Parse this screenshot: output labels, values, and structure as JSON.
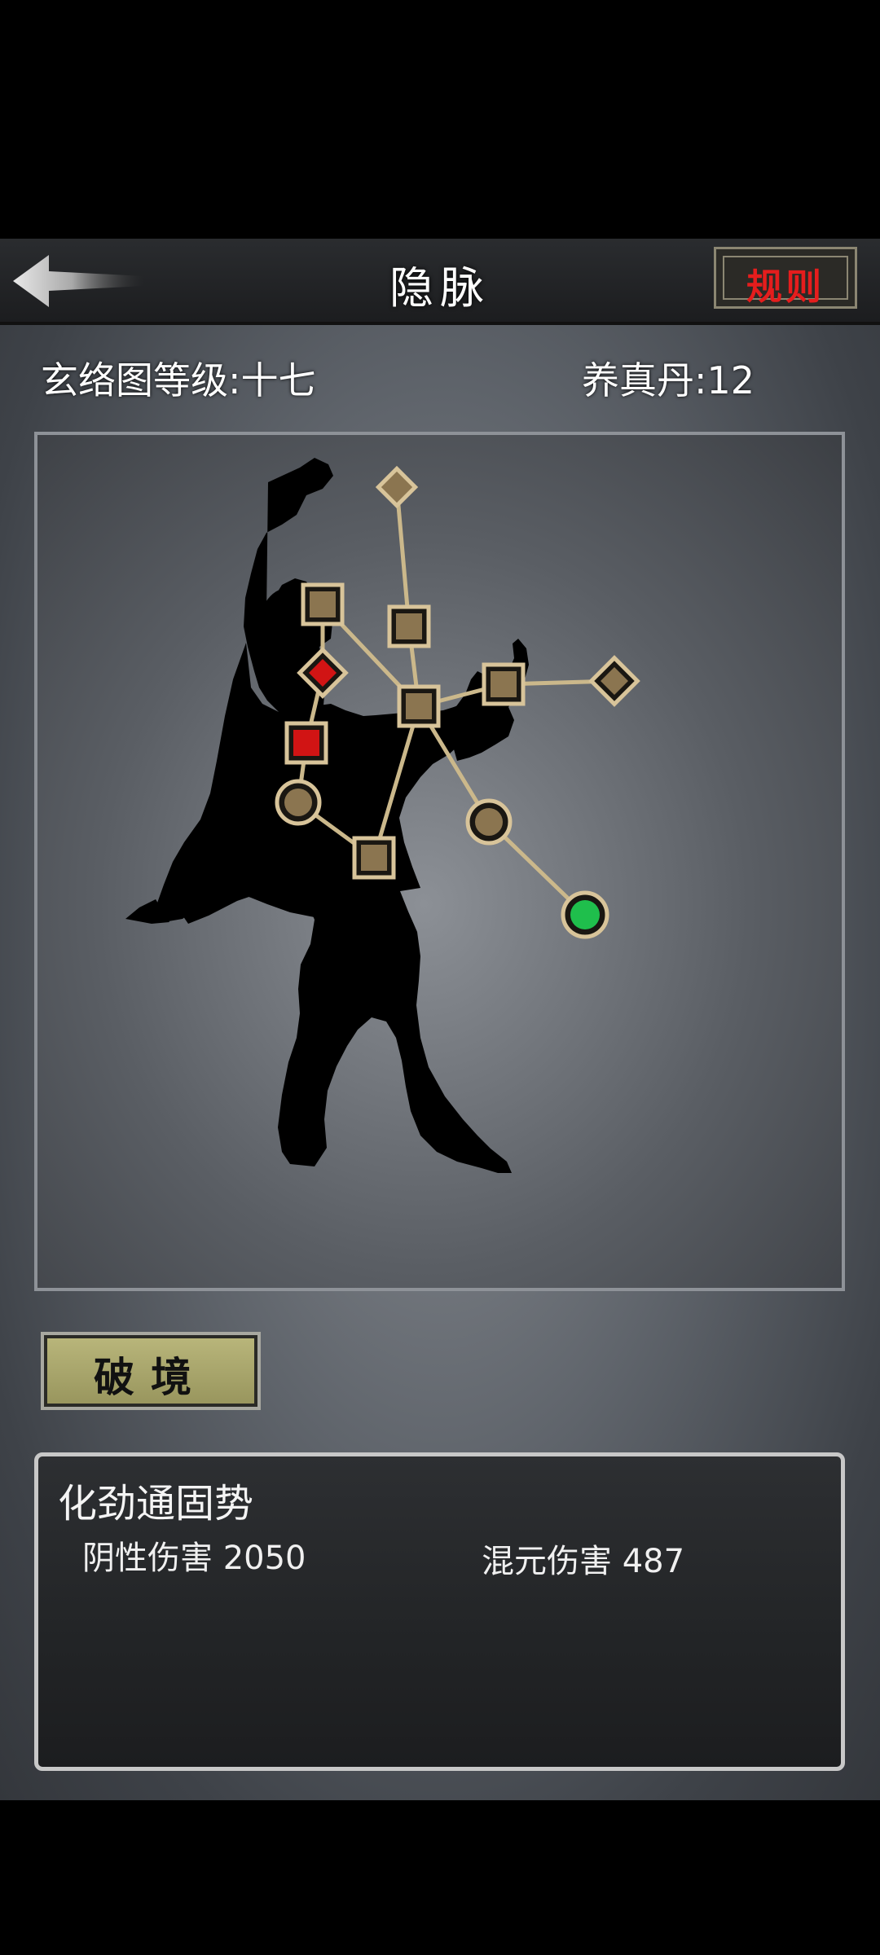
{
  "header": {
    "title": "隐脉",
    "rules_label": "规则"
  },
  "stats": {
    "map_level_text": "玄络图等级:十七",
    "pill_text": "养真丹:12"
  },
  "meridian_nodes": [
    {
      "id": "top-hand",
      "shape": "diamond",
      "state": "unlocked"
    },
    {
      "id": "left-shoulder",
      "shape": "square",
      "state": "unlocked"
    },
    {
      "id": "neck",
      "shape": "square",
      "state": "unlocked"
    },
    {
      "id": "left-chest",
      "shape": "diamond",
      "state": "special-red"
    },
    {
      "id": "center",
      "shape": "square",
      "state": "unlocked"
    },
    {
      "id": "right-elbow",
      "shape": "square",
      "state": "unlocked"
    },
    {
      "id": "right-hand",
      "shape": "diamond",
      "state": "unlocked"
    },
    {
      "id": "left-waist",
      "shape": "square",
      "state": "special-red"
    },
    {
      "id": "left-hip",
      "shape": "circle",
      "state": "unlocked"
    },
    {
      "id": "left-knee",
      "shape": "square",
      "state": "unlocked"
    },
    {
      "id": "right-knee",
      "shape": "circle",
      "state": "unlocked"
    },
    {
      "id": "right-foot",
      "shape": "circle",
      "state": "active-green"
    }
  ],
  "colors": {
    "node_fill": "#8b7550",
    "node_border": "#d8c49a",
    "link": "#d9c79a",
    "red_node": "#d11414",
    "green_node": "#1fbf4c",
    "rules_text": "#e51d1d",
    "button_face": "#b0ad70"
  },
  "breakthrough_label": "破境",
  "info": {
    "skill_name": "化劲通固势",
    "effects": [
      {
        "text": "阴性伤害 2050"
      },
      {
        "text": "混元伤害 487"
      }
    ]
  },
  "icons": {
    "back": "arrow-left-icon",
    "rules_frame": "ornate-frame-icon"
  }
}
